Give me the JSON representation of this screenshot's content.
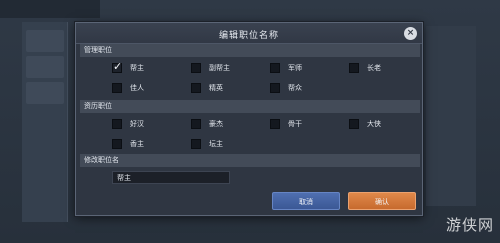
{
  "dialog": {
    "title": "编辑职位名称",
    "close_icon": "×"
  },
  "sections": {
    "management": "管理职位",
    "seniority": "资历职位",
    "rename": "修改职位名"
  },
  "management_options": [
    {
      "label": "帮主",
      "checked": true
    },
    {
      "label": "副帮主",
      "checked": false
    },
    {
      "label": "军师",
      "checked": false
    },
    {
      "label": "长老",
      "checked": false
    },
    {
      "label": "佳人",
      "checked": false
    },
    {
      "label": "精英",
      "checked": false
    },
    {
      "label": "帮众",
      "checked": false
    }
  ],
  "seniority_options": [
    {
      "label": "好汉",
      "checked": false
    },
    {
      "label": "豪杰",
      "checked": false
    },
    {
      "label": "骨干",
      "checked": false
    },
    {
      "label": "大侠",
      "checked": false
    },
    {
      "label": "香主",
      "checked": false
    },
    {
      "label": "坛主",
      "checked": false
    }
  ],
  "rename_input": {
    "value": "帮主"
  },
  "buttons": {
    "cancel": "取消",
    "confirm": "确认"
  },
  "watermark": "游侠网"
}
